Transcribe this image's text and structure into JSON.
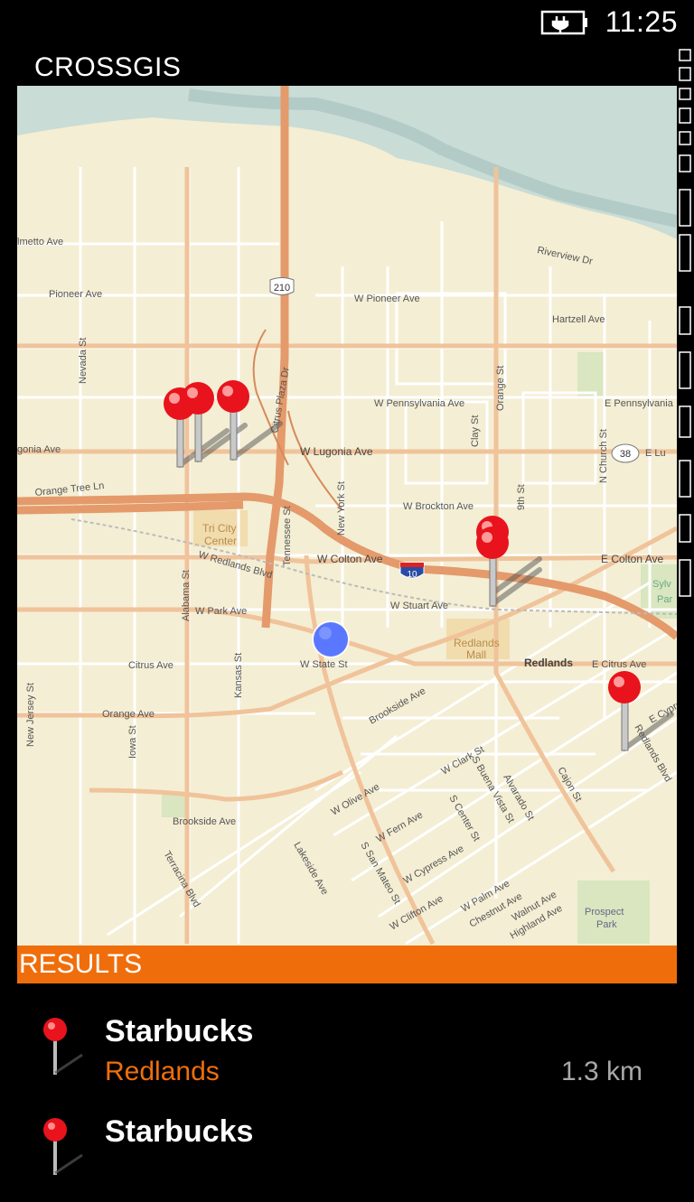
{
  "status": {
    "time": "11:25",
    "battery_icon": "battery-charging-icon"
  },
  "app": {
    "title": "CROSSGIS"
  },
  "map": {
    "streets": {
      "imetto": "lmetto Ave",
      "pioneer": "Pioneer Ave",
      "w_pioneer": "W Pioneer Ave",
      "riverview": "Riverview Dr",
      "hartzell": "Hartzell Ave",
      "w_pennsylvania": "W Pennsylvania Ave",
      "e_pennsylvania": "E Pennsylvania",
      "nevada": "Nevada St",
      "citrus_plaza": "Citrus Plaza Dr",
      "lugonia": "gonia Ave",
      "w_lugonia": "W Lugonia Ave",
      "e_lugonia": "E Lu",
      "clay": "Clay St",
      "orange_st": "Orange St",
      "n_church": "N Church St",
      "orange_tree": "Orange Tree Ln",
      "w_brockton": "W Brockton Ave",
      "ninth": "9th St",
      "tri_city": "Tri City",
      "center": "Center",
      "alabama": "Alabama St",
      "w_redlands": "W Redlands Blvd",
      "tennessee": "Tennessee St",
      "new_york": "New York St",
      "w_colton": "W Colton Ave",
      "e_colton": "E Colton Ave",
      "w_stuart": "W Stuart Ave",
      "w_park": "W Park Ave",
      "citrus": "Citrus Ave",
      "w_state": "W State St",
      "redlands_mall": "Redlands",
      "mall": "Mall",
      "redlands": "Redlands",
      "e_citrus": "E Citrus Ave",
      "new_jersey": "New Jersey St",
      "orange_ave": "Orange Ave",
      "iowa": "Iowa St",
      "kansas": "Kansas St",
      "brookside": "Brookside Ave",
      "brookside2": "Brookside Ave",
      "w_olive": "W Olive Ave",
      "w_clark": "W Clark St",
      "s_buena_vista": "S Buena Vista St",
      "alvarado": "Alvarado St",
      "cajon": "Cajon St",
      "redlands_blvd": "Redlands Blvd",
      "w_fern": "W Fern Ave",
      "s_center": "S Center St",
      "w_cypress": "W Cypress Ave",
      "terracina": "Terracina Blvd",
      "lakeside": "Lakeside Ave",
      "s_san_mateo": "S San Mateo St",
      "w_clifton": "W Clifton Ave",
      "w_palm": "W Palm Ave",
      "chestnut": "Chestnut Ave",
      "walnut": "Walnut Ave",
      "highland": "Highland Ave",
      "prospect": "Prospect",
      "park": "Park",
      "sylv": "Sylv",
      "par": "Par",
      "e_cypr": "E Cypre"
    },
    "shields": {
      "hwy210": "210",
      "i10": "10",
      "hwy38": "38"
    },
    "colors": {
      "land": "#f4eed4",
      "road_major": "#e69a6b",
      "road_minor": "#ffffff",
      "river": "#c4d8d4",
      "pin": "#e8131c",
      "location": "#5a78ff"
    }
  },
  "results": {
    "header": "RESULTS",
    "items": [
      {
        "name": "Starbucks",
        "city": "Redlands",
        "distance": "1.3 km"
      },
      {
        "name": "Starbucks",
        "city": "",
        "distance": ""
      }
    ]
  },
  "theme": {
    "accent": "#ef6e0b",
    "background": "#000000"
  }
}
